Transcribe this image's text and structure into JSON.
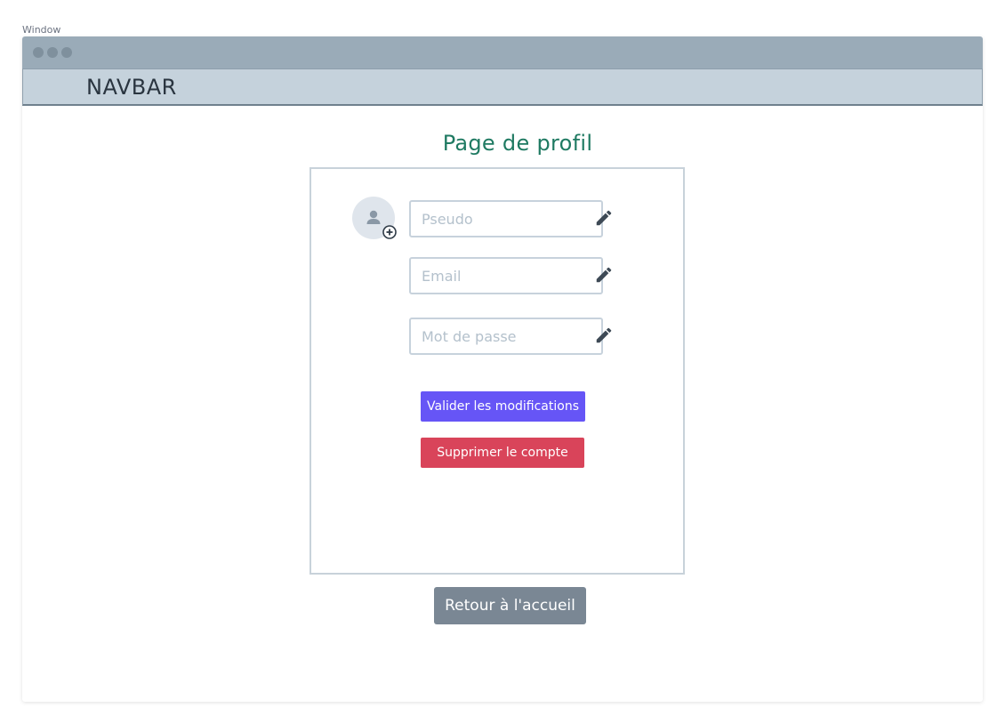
{
  "window": {
    "label": "Window"
  },
  "navbar": {
    "title": "NAVBAR"
  },
  "page": {
    "title": "Page de profil"
  },
  "profile": {
    "avatar_icon": "user-add-icon",
    "fields": {
      "pseudo": {
        "placeholder": "Pseudo",
        "value": ""
      },
      "email": {
        "placeholder": "Email",
        "value": ""
      },
      "password": {
        "placeholder": "Mot de passe",
        "value": ""
      }
    },
    "edit_icon": "pencil-icon",
    "validate_label": "Valider les modifications",
    "delete_label": "Supprimer le compte"
  },
  "footer": {
    "back_label": "Retour à l'accueil"
  },
  "colors": {
    "title": "#1f7a62",
    "primary": "#6655f6",
    "danger": "#d9445a",
    "secondary": "#7a8794"
  }
}
